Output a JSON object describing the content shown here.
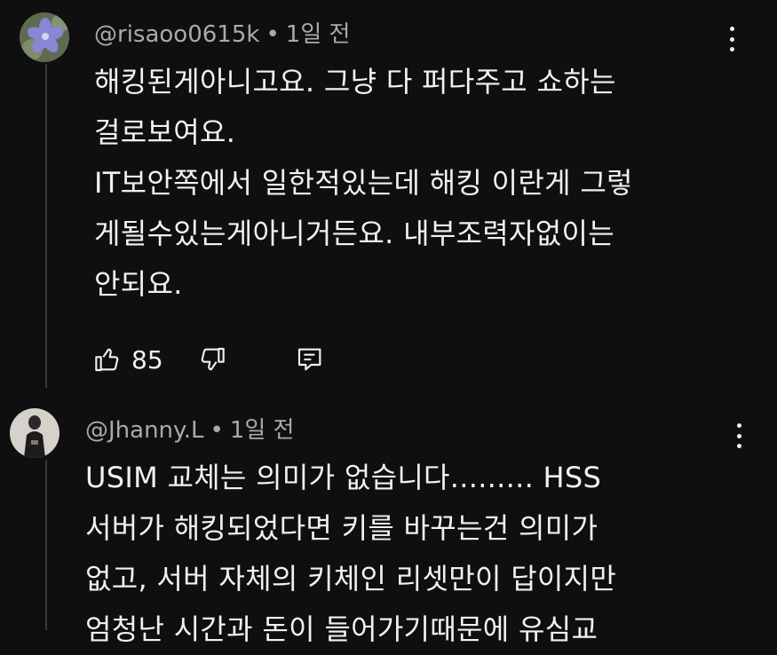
{
  "comments": [
    {
      "handle": "@risaoo0615k",
      "separator": "•",
      "time": "1일 전",
      "lines": [
        "해킹된게아니고요. 그냥 다 퍼다주고 쇼하는",
        "걸로보여요.",
        "IT보안쪽에서 일한적있는데 해킹 이란게 그렇",
        "게될수있는게아니거든요. 내부조력자없이는",
        "안되요."
      ],
      "likes": "85"
    },
    {
      "handle": "@Jhanny.L",
      "separator": "•",
      "time": "1일 전",
      "lines": [
        "USIM 교체는 의미가 없습니다......... HSS",
        "서버가 해킹되었다면 키를 바꾸는건 의미가",
        "없고, 서버 자체의 키체인 리셋만이 답이지만",
        "엄청난 시간과 돈이 들어가기때문에 유심교"
      ]
    }
  ],
  "icons": {
    "like": "thumbs-up-icon",
    "dislike": "thumbs-down-icon",
    "reply": "reply-icon",
    "more": "kebab-menu-icon"
  }
}
